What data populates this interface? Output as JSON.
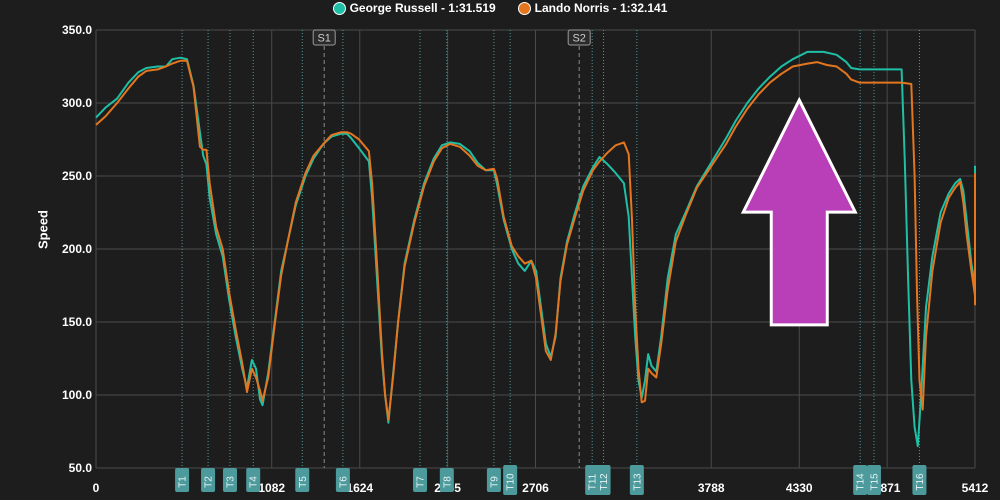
{
  "colors": {
    "background": "#1d1d1d",
    "grid": "#4a4a4a",
    "axis_text": "#ffffff",
    "sector_line": "#8a8a8a",
    "turn_line": "#5fc4c4",
    "turn_badge": "#4d9a9c",
    "arrow_fill": "#b83fb8",
    "arrow_stroke": "#ffffff"
  },
  "legend": [
    {
      "label": "George Russell - 1:31.519",
      "color": "#1fbfa6"
    },
    {
      "label": "Lando Norris - 1:32.141",
      "color": "#e3761f"
    }
  ],
  "annotation": {
    "type": "arrow-up",
    "icon": "arrow-up-icon",
    "color": "#b83fb8",
    "tip_x": 4330,
    "tip_y": 302,
    "base_y": 148
  },
  "chart_data": {
    "type": "line",
    "title": "",
    "xlabel": "",
    "ylabel": "Speed",
    "xlim": [
      0,
      5412
    ],
    "ylim": [
      50,
      350
    ],
    "grid": true,
    "legend_position": "top-center",
    "x_ticks": [
      0,
      1082,
      1624,
      2165,
      2706,
      3788,
      4330,
      4871,
      5412
    ],
    "x_tick_labels": [
      "0",
      "1082",
      "1624",
      "2165",
      "2706",
      "3788",
      "4330",
      "4871",
      "5412"
    ],
    "y_ticks": [
      50,
      100,
      150,
      200,
      250,
      300,
      350
    ],
    "y_tick_labels": [
      "50.0",
      "100.0",
      "150.0",
      "200.0",
      "250.0",
      "300.0",
      "350.0"
    ],
    "sectors": [
      {
        "label": "S1",
        "x": 1405
      },
      {
        "label": "S2",
        "x": 2975
      }
    ],
    "turns": [
      {
        "label": "T1",
        "x": 530
      },
      {
        "label": "T2",
        "x": 690
      },
      {
        "label": "T3",
        "x": 825
      },
      {
        "label": "T4",
        "x": 968
      },
      {
        "label": "T5",
        "x": 1270
      },
      {
        "label": "T6",
        "x": 1520
      },
      {
        "label": "T7",
        "x": 1995
      },
      {
        "label": "T8",
        "x": 2160
      },
      {
        "label": "T9",
        "x": 2450
      },
      {
        "label": "T10",
        "x": 2550
      },
      {
        "label": "T11",
        "x": 3055
      },
      {
        "label": "T12",
        "x": 3125
      },
      {
        "label": "T13",
        "x": 3330
      },
      {
        "label": "T14",
        "x": 4705
      },
      {
        "label": "T15",
        "x": 4790
      },
      {
        "label": "T16",
        "x": 5070
      }
    ],
    "series": [
      {
        "name": "George Russell - 1:31.519",
        "color": "#1fbfa6",
        "points": [
          [
            0,
            290
          ],
          [
            60,
            297
          ],
          [
            130,
            303
          ],
          [
            200,
            314
          ],
          [
            260,
            321
          ],
          [
            310,
            324
          ],
          [
            380,
            325
          ],
          [
            430,
            325
          ],
          [
            470,
            330
          ],
          [
            520,
            331
          ],
          [
            560,
            330
          ],
          [
            600,
            312
          ],
          [
            640,
            280
          ],
          [
            660,
            264
          ],
          [
            680,
            258
          ],
          [
            700,
            235
          ],
          [
            740,
            210
          ],
          [
            780,
            195
          ],
          [
            820,
            165
          ],
          [
            860,
            140
          ],
          [
            900,
            118
          ],
          [
            930,
            105
          ],
          [
            960,
            124
          ],
          [
            985,
            118
          ],
          [
            1010,
            97
          ],
          [
            1025,
            93
          ],
          [
            1060,
            115
          ],
          [
            1100,
            150
          ],
          [
            1140,
            185
          ],
          [
            1180,
            205
          ],
          [
            1230,
            230
          ],
          [
            1290,
            250
          ],
          [
            1340,
            262
          ],
          [
            1400,
            272
          ],
          [
            1450,
            277
          ],
          [
            1510,
            279
          ],
          [
            1545,
            279
          ],
          [
            1570,
            276
          ],
          [
            1620,
            269
          ],
          [
            1680,
            260
          ],
          [
            1700,
            235
          ],
          [
            1730,
            180
          ],
          [
            1760,
            125
          ],
          [
            1780,
            100
          ],
          [
            1800,
            81
          ],
          [
            1830,
            115
          ],
          [
            1860,
            150
          ],
          [
            1900,
            190
          ],
          [
            1960,
            220
          ],
          [
            2020,
            245
          ],
          [
            2080,
            262
          ],
          [
            2130,
            271
          ],
          [
            2180,
            273
          ],
          [
            2240,
            272
          ],
          [
            2300,
            267
          ],
          [
            2350,
            259
          ],
          [
            2400,
            254
          ],
          [
            2450,
            254
          ],
          [
            2470,
            244
          ],
          [
            2510,
            220
          ],
          [
            2560,
            200
          ],
          [
            2600,
            190
          ],
          [
            2640,
            185
          ],
          [
            2680,
            192
          ],
          [
            2710,
            185
          ],
          [
            2740,
            160
          ],
          [
            2770,
            135
          ],
          [
            2800,
            126
          ],
          [
            2830,
            140
          ],
          [
            2860,
            180
          ],
          [
            2900,
            205
          ],
          [
            2950,
            225
          ],
          [
            3000,
            243
          ],
          [
            3060,
            256
          ],
          [
            3100,
            263
          ],
          [
            3150,
            258
          ],
          [
            3200,
            252
          ],
          [
            3250,
            245
          ],
          [
            3280,
            222
          ],
          [
            3300,
            180
          ],
          [
            3320,
            140
          ],
          [
            3340,
            110
          ],
          [
            3360,
            98
          ],
          [
            3380,
            110
          ],
          [
            3400,
            128
          ],
          [
            3420,
            120
          ],
          [
            3450,
            116
          ],
          [
            3480,
            140
          ],
          [
            3520,
            180
          ],
          [
            3570,
            210
          ],
          [
            3630,
            225
          ],
          [
            3700,
            243
          ],
          [
            3760,
            254
          ],
          [
            3820,
            265
          ],
          [
            3880,
            276
          ],
          [
            3940,
            288
          ],
          [
            4010,
            300
          ],
          [
            4080,
            310
          ],
          [
            4150,
            318
          ],
          [
            4220,
            325
          ],
          [
            4290,
            330
          ],
          [
            4380,
            335
          ],
          [
            4480,
            335
          ],
          [
            4560,
            333
          ],
          [
            4620,
            328
          ],
          [
            4650,
            324
          ],
          [
            4700,
            323
          ],
          [
            4800,
            323
          ],
          [
            4900,
            323
          ],
          [
            4960,
            323
          ],
          [
            4980,
            260
          ],
          [
            5000,
            180
          ],
          [
            5020,
            110
          ],
          [
            5040,
            78
          ],
          [
            5060,
            65
          ],
          [
            5080,
            100
          ],
          [
            5110,
            160
          ],
          [
            5150,
            195
          ],
          [
            5200,
            225
          ],
          [
            5250,
            238
          ],
          [
            5290,
            245
          ],
          [
            5320,
            248
          ],
          [
            5340,
            240
          ],
          [
            5360,
            220
          ],
          [
            5390,
            190
          ],
          [
            5420,
            175
          ],
          [
            5450,
            170
          ],
          [
            5490,
            185
          ],
          [
            5530,
            215
          ],
          [
            5570,
            240
          ],
          [
            5610,
            255
          ],
          [
            5650,
            257
          ]
        ]
      },
      {
        "name": "Lando Norris - 1:32.141",
        "color": "#e3761f",
        "points": [
          [
            0,
            285
          ],
          [
            60,
            291
          ],
          [
            130,
            300
          ],
          [
            200,
            310
          ],
          [
            260,
            318
          ],
          [
            310,
            322
          ],
          [
            380,
            323
          ],
          [
            430,
            325
          ],
          [
            470,
            327
          ],
          [
            520,
            329
          ],
          [
            560,
            329
          ],
          [
            600,
            311
          ],
          [
            640,
            270
          ],
          [
            660,
            268
          ],
          [
            680,
            268
          ],
          [
            700,
            245
          ],
          [
            740,
            215
          ],
          [
            780,
            200
          ],
          [
            820,
            170
          ],
          [
            860,
            145
          ],
          [
            900,
            122
          ],
          [
            930,
            102
          ],
          [
            960,
            118
          ],
          [
            985,
            112
          ],
          [
            1010,
            103
          ],
          [
            1025,
            96
          ],
          [
            1060,
            112
          ],
          [
            1100,
            148
          ],
          [
            1140,
            182
          ],
          [
            1180,
            205
          ],
          [
            1230,
            232
          ],
          [
            1290,
            252
          ],
          [
            1340,
            264
          ],
          [
            1400,
            272
          ],
          [
            1450,
            278
          ],
          [
            1510,
            280
          ],
          [
            1545,
            280
          ],
          [
            1570,
            279
          ],
          [
            1620,
            275
          ],
          [
            1680,
            267
          ],
          [
            1700,
            245
          ],
          [
            1730,
            190
          ],
          [
            1760,
            130
          ],
          [
            1780,
            100
          ],
          [
            1800,
            83
          ],
          [
            1830,
            113
          ],
          [
            1860,
            150
          ],
          [
            1900,
            188
          ],
          [
            1960,
            218
          ],
          [
            2020,
            243
          ],
          [
            2080,
            260
          ],
          [
            2130,
            269
          ],
          [
            2180,
            272
          ],
          [
            2240,
            270
          ],
          [
            2300,
            264
          ],
          [
            2350,
            257
          ],
          [
            2400,
            254
          ],
          [
            2450,
            255
          ],
          [
            2470,
            248
          ],
          [
            2510,
            222
          ],
          [
            2560,
            202
          ],
          [
            2600,
            195
          ],
          [
            2640,
            190
          ],
          [
            2680,
            192
          ],
          [
            2710,
            180
          ],
          [
            2740,
            155
          ],
          [
            2770,
            130
          ],
          [
            2800,
            124
          ],
          [
            2830,
            142
          ],
          [
            2860,
            178
          ],
          [
            2900,
            203
          ],
          [
            2950,
            222
          ],
          [
            3000,
            240
          ],
          [
            3060,
            254
          ],
          [
            3100,
            260
          ],
          [
            3150,
            266
          ],
          [
            3200,
            271
          ],
          [
            3250,
            273
          ],
          [
            3280,
            265
          ],
          [
            3300,
            220
          ],
          [
            3320,
            160
          ],
          [
            3340,
            118
          ],
          [
            3360,
            95
          ],
          [
            3380,
            96
          ],
          [
            3400,
            118
          ],
          [
            3420,
            115
          ],
          [
            3450,
            112
          ],
          [
            3480,
            135
          ],
          [
            3520,
            172
          ],
          [
            3570,
            205
          ],
          [
            3630,
            223
          ],
          [
            3700,
            242
          ],
          [
            3760,
            252
          ],
          [
            3820,
            262
          ],
          [
            3880,
            272
          ],
          [
            3940,
            284
          ],
          [
            4010,
            296
          ],
          [
            4080,
            306
          ],
          [
            4150,
            314
          ],
          [
            4220,
            320
          ],
          [
            4290,
            325
          ],
          [
            4380,
            327
          ],
          [
            4440,
            328
          ],
          [
            4500,
            326
          ],
          [
            4560,
            325
          ],
          [
            4620,
            320
          ],
          [
            4650,
            316
          ],
          [
            4700,
            314
          ],
          [
            4800,
            314
          ],
          [
            4900,
            314
          ],
          [
            4960,
            314
          ],
          [
            5020,
            313
          ],
          [
            5040,
            250
          ],
          [
            5055,
            170
          ],
          [
            5070,
            110
          ],
          [
            5090,
            90
          ],
          [
            5110,
            140
          ],
          [
            5150,
            185
          ],
          [
            5200,
            218
          ],
          [
            5250,
            235
          ],
          [
            5290,
            242
          ],
          [
            5320,
            246
          ],
          [
            5340,
            232
          ],
          [
            5360,
            210
          ],
          [
            5390,
            185
          ],
          [
            5420,
            168
          ],
          [
            5450,
            162
          ],
          [
            5490,
            182
          ],
          [
            5530,
            210
          ],
          [
            5570,
            235
          ],
          [
            5610,
            250
          ],
          [
            5650,
            252
          ]
        ]
      }
    ]
  }
}
